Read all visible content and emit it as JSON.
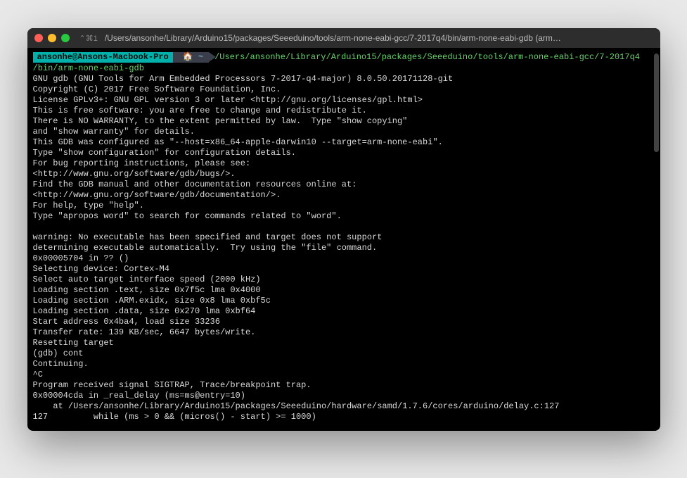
{
  "titlebar": {
    "meta_keys": "⌃⌘1",
    "title": "/Users/ansonhe/Library/Arduino15/packages/Seeeduino/tools/arm-none-eabi-gcc/7-2017q4/bin/arm-none-eabi-gdb (arm…"
  },
  "prompt": {
    "user_host": "ansonhe@Ansons-Macbook-Pro",
    "home_glyph": "🏠 ~",
    "command_line1": "/Users/ansonhe/Library/Arduino15/packages/Seeeduino/tools/arm-none-eabi-gcc/7-2017q4",
    "command_line2": "/bin/arm-none-eabi-gdb"
  },
  "output": "GNU gdb (GNU Tools for Arm Embedded Processors 7-2017-q4-major) 8.0.50.20171128-git\nCopyright (C) 2017 Free Software Foundation, Inc.\nLicense GPLv3+: GNU GPL version 3 or later <http://gnu.org/licenses/gpl.html>\nThis is free software: you are free to change and redistribute it.\nThere is NO WARRANTY, to the extent permitted by law.  Type \"show copying\"\nand \"show warranty\" for details.\nThis GDB was configured as \"--host=x86_64-apple-darwin10 --target=arm-none-eabi\".\nType \"show configuration\" for configuration details.\nFor bug reporting instructions, please see:\n<http://www.gnu.org/software/gdb/bugs/>.\nFind the GDB manual and other documentation resources online at:\n<http://www.gnu.org/software/gdb/documentation/>.\nFor help, type \"help\".\nType \"apropos word\" to search for commands related to \"word\".\n\nwarning: No executable has been specified and target does not support\ndetermining executable automatically.  Try using the \"file\" command.\n0x00005704 in ?? ()\nSelecting device: Cortex-M4\nSelect auto target interface speed (2000 kHz)\nLoading section .text, size 0x7f5c lma 0x4000\nLoading section .ARM.exidx, size 0x8 lma 0xbf5c\nLoading section .data, size 0x270 lma 0xbf64\nStart address 0x4ba4, load size 33236\nTransfer rate: 139 KB/sec, 6647 bytes/write.\nResetting target\n(gdb) cont\nContinuing.\n^C\nProgram received signal SIGTRAP, Trace/breakpoint trap.\n0x00004cda in _real_delay (ms=ms@entry=10)\n    at /Users/ansonhe/Library/Arduino15/packages/Seeeduino/hardware/samd/1.7.6/cores/arduino/delay.c:127\n127         while (ms > 0 && (micros() - start) >= 1000)"
}
